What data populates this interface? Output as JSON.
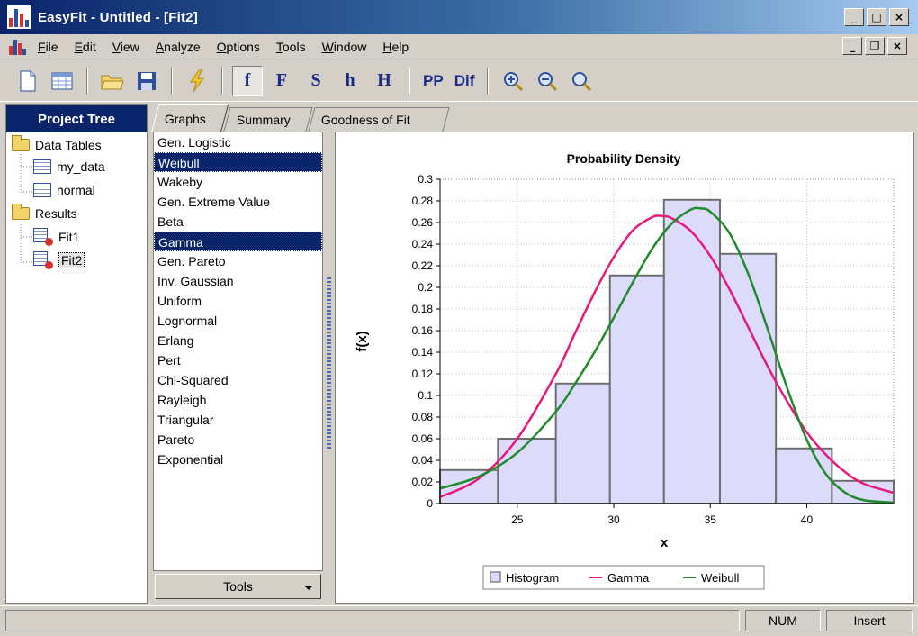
{
  "window": {
    "title": "EasyFit  -  Untitled - [Fit2]"
  },
  "menu": [
    "File",
    "Edit",
    "View",
    "Analyze",
    "Options",
    "Tools",
    "Window",
    "Help"
  ],
  "toolbar": {
    "letters": [
      "f",
      "F",
      "S",
      "h",
      "H"
    ],
    "text_buttons": [
      "PP",
      "Dif"
    ]
  },
  "tree": {
    "header": "Project Tree",
    "data_tables": "Data Tables",
    "tables": [
      "my_data",
      "normal"
    ],
    "results": "Results",
    "fits": [
      "Fit1",
      "Fit2"
    ]
  },
  "tabs": [
    "Graphs",
    "Summary",
    "Goodness of Fit"
  ],
  "distributions": [
    "Gen. Logistic",
    "Weibull",
    "Wakeby",
    "Gen. Extreme Value",
    "Beta",
    "Gamma",
    "Gen. Pareto",
    "Inv. Gaussian",
    "Uniform",
    "Lognormal",
    "Erlang",
    "Pert",
    "Chi-Squared",
    "Rayleigh",
    "Triangular",
    "Pareto",
    "Exponential"
  ],
  "selected_distributions": [
    "Weibull",
    "Gamma"
  ],
  "tools_label": "Tools",
  "status": {
    "num": "NUM",
    "insert": "Insert"
  },
  "colors": {
    "gamma": "#e6197e",
    "weibull": "#1f8a2c",
    "histogram_fill": "#dcdcfa",
    "histogram_edge": "#6e6e6e",
    "title_blue": "#0a246a"
  },
  "chart_data": {
    "type": "bar",
    "title": "Probability Density",
    "xlabel": "x",
    "ylabel": "f(x)",
    "xlim": [
      21,
      44.5
    ],
    "ylim": [
      0,
      0.3
    ],
    "xticks": [
      25,
      30,
      35,
      40
    ],
    "yticks": [
      0,
      0.02,
      0.04,
      0.06,
      0.08,
      0.1,
      0.12,
      0.14,
      0.16,
      0.18,
      0.2,
      0.22,
      0.24,
      0.26,
      0.28,
      0.3
    ],
    "histogram": {
      "name": "Histogram",
      "bins": [
        [
          21,
          24
        ],
        [
          24,
          27
        ],
        [
          27,
          29.8
        ],
        [
          29.8,
          32.6
        ],
        [
          32.6,
          35.5
        ],
        [
          35.5,
          38.4
        ],
        [
          38.4,
          41.3
        ],
        [
          41.3,
          44.5
        ]
      ],
      "values": [
        0.031,
        0.06,
        0.111,
        0.211,
        0.281,
        0.231,
        0.051,
        0.021
      ]
    },
    "series": [
      {
        "name": "Gamma",
        "x": [
          21,
          23,
          25,
          27,
          28,
          29,
          30,
          31,
          32,
          32.5,
          33,
          34,
          35,
          36,
          37,
          38,
          39,
          40,
          41,
          42,
          43,
          44.5
        ],
        "y": [
          0.006,
          0.023,
          0.06,
          0.12,
          0.158,
          0.195,
          0.228,
          0.253,
          0.265,
          0.266,
          0.264,
          0.252,
          0.229,
          0.198,
          0.162,
          0.126,
          0.094,
          0.066,
          0.045,
          0.029,
          0.018,
          0.01
        ]
      },
      {
        "name": "Weibull",
        "x": [
          21,
          23,
          25,
          27,
          28,
          29,
          30,
          31,
          32,
          33,
          34,
          34.5,
          35,
          36,
          37,
          38,
          39,
          40,
          41,
          42,
          43,
          44.5
        ],
        "y": [
          0.014,
          0.025,
          0.047,
          0.085,
          0.111,
          0.14,
          0.172,
          0.205,
          0.236,
          0.259,
          0.272,
          0.273,
          0.27,
          0.25,
          0.211,
          0.16,
          0.106,
          0.059,
          0.027,
          0.01,
          0.003,
          0.001
        ]
      }
    ],
    "legend_position": "bottom-center",
    "grid": true
  }
}
